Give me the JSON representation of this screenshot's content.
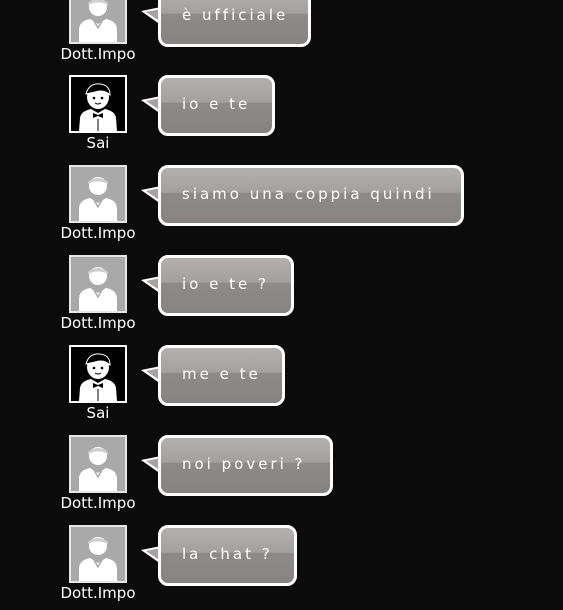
{
  "conversation": {
    "messages": [
      {
        "sender": "Dott.Impo",
        "avatar": "dott-avatar-icon",
        "text": "è ufficiale"
      },
      {
        "sender": "Sai",
        "avatar": "sai-avatar-icon",
        "text": "io e te"
      },
      {
        "sender": "Dott.Impo",
        "avatar": "dott-avatar-icon",
        "text": "siamo una coppia quindi"
      },
      {
        "sender": "Dott.Impo",
        "avatar": "dott-avatar-icon",
        "text": "io e te ?"
      },
      {
        "sender": "Sai",
        "avatar": "sai-avatar-icon",
        "text": "me e te"
      },
      {
        "sender": "Dott.Impo",
        "avatar": "dott-avatar-icon",
        "text": "noi poveri ?"
      },
      {
        "sender": "Dott.Impo",
        "avatar": "dott-avatar-icon",
        "text": "la chat ?"
      }
    ]
  },
  "colors": {
    "background": "#0b0b0b",
    "bubble_top": "#b3b0af",
    "bubble_bottom": "#868382",
    "bubble_border": "#ffffff",
    "text": "#ffffff"
  }
}
